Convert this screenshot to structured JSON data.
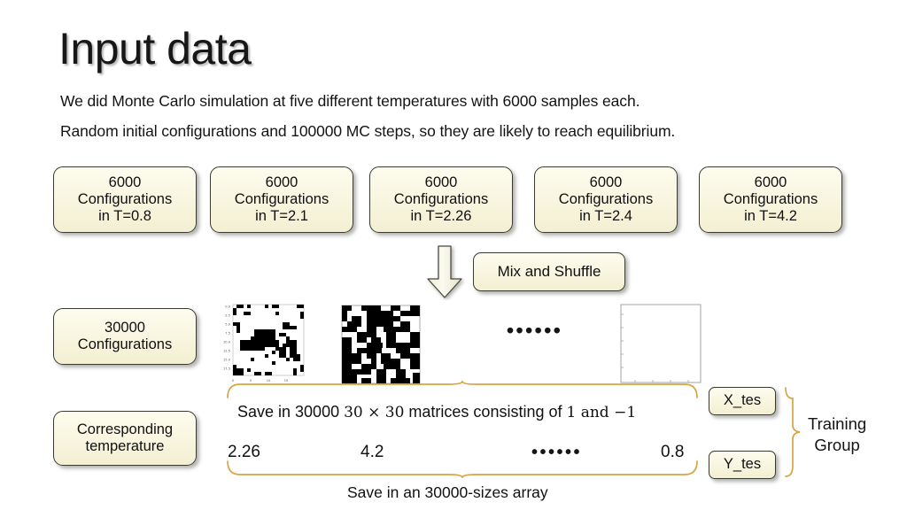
{
  "slide": {
    "title": "Input data",
    "body_lines": [
      "We did Monte Carlo simulation at five different temperatures with 6000 samples each.",
      "Random initial configurations and 100000 MC steps, so they are likely to reach equilibrium."
    ]
  },
  "temperature_boxes": [
    {
      "count": "6000",
      "label": "Configurations",
      "temperature": "in T=0.8"
    },
    {
      "count": "6000",
      "label": "Configurations",
      "temperature": "in T=2.1"
    },
    {
      "count": "6000",
      "label": "Configurations",
      "temperature": "in T=2.26"
    },
    {
      "count": "6000",
      "label": "Configurations",
      "temperature": "in T=2.4"
    },
    {
      "count": "6000",
      "label": "Configurations",
      "temperature": "in T=4.2"
    }
  ],
  "mix_box": {
    "label": "Mix and Shuffle"
  },
  "merged_box": {
    "count": "30000",
    "label": "Configurations"
  },
  "corresponding_box": {
    "line1": "Corresponding",
    "line2": "temperature"
  },
  "ellipsis": {
    "matrices": "••••••",
    "temperatures": "••••••"
  },
  "captions": {
    "matrices_prefix": "Save in 30000 ",
    "matrices_dims": "30 × 30",
    "matrices_middle": " matrices consisting of ",
    "matrices_values": "1 and −1",
    "array": "Save in an 30000-sizes array"
  },
  "temperature_values": [
    "2.26",
    "4.2",
    "0.8"
  ],
  "test_boxes": [
    {
      "label": "X_tes"
    },
    {
      "label": "Y_tes"
    }
  ],
  "training_group": {
    "line1": "Training",
    "line2": "Group"
  },
  "plots": {
    "axis_y_ticks": [
      "0.0",
      "2.5",
      "5.0",
      "7.5",
      "10.0",
      "12.5",
      "15.0",
      "17.5"
    ],
    "axis_x_ticks": [
      "0",
      "5",
      "10",
      "15"
    ],
    "plot1_density": "low",
    "plot2_density": "high",
    "plot3_density": "empty"
  },
  "colors": {
    "box_fill": "#f8f5df",
    "box_border": "#3a3a32",
    "brace": "#d9a441",
    "text": "#111111",
    "background": "#ffffff",
    "spin_up": "#000000",
    "spin_down": "#ffffff"
  }
}
